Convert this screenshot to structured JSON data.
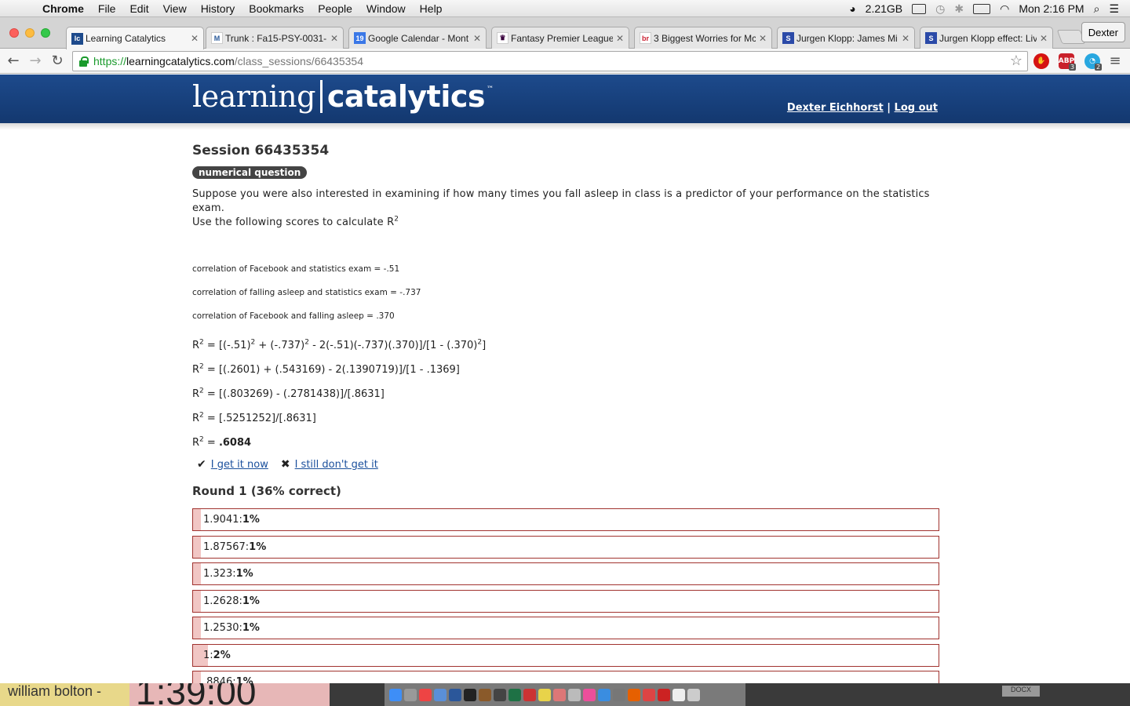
{
  "menubar": {
    "app_name": "Chrome",
    "menus": [
      "File",
      "Edit",
      "View",
      "History",
      "Bookmarks",
      "People",
      "Window",
      "Help"
    ],
    "memory": "2.21GB",
    "clock": "Mon 2:16 PM"
  },
  "tabs": [
    {
      "title": "Learning Catalytics",
      "favicon": "lc",
      "active": true
    },
    {
      "title": "Trunk : Fa15-PSY-0031-",
      "favicon": "trunk"
    },
    {
      "title": "Google Calendar - Mont",
      "favicon": "19"
    },
    {
      "title": "Fantasy Premier League",
      "favicon": "fpl"
    },
    {
      "title": "3 Biggest Worries for Mc",
      "favicon": "br"
    },
    {
      "title": "Jurgen Klopp: James Mi",
      "favicon": "S"
    },
    {
      "title": "Jurgen Klopp effect: Live",
      "favicon": "S"
    }
  ],
  "profile_name": "Dexter",
  "address": {
    "scheme": "https://",
    "host": "learningcatalytics.com",
    "path": "/class_sessions/66435354"
  },
  "extensions": {
    "abp_count": "3",
    "ghostery_count": "2",
    "abp_label": "ABP"
  },
  "site": {
    "logo_left": "learning",
    "logo_right": "catalytics",
    "logo_tm": "™",
    "user_name": "Dexter Eichhorst",
    "separator": "|",
    "logout": "Log out"
  },
  "session": {
    "title": "Session 66435354",
    "question_type": "numerical question",
    "question_line1": "Suppose you were also interested in examining if how many times you fall asleep in class is a predictor of your performance on the statistics exam.",
    "question_line2": "Use the following scores to calculate R",
    "sup2": "2",
    "correlations": [
      "correlation of Facebook and statistics exam = -.51",
      "correlation of falling asleep and statistics exam = -.737",
      "correlation of Facebook and falling asleep = .370"
    ],
    "equations": {
      "eq1_a": "R",
      "eq1_b": " = [(-.51)",
      "eq1_c": " + (-.737)",
      "eq1_d": " - 2(-.51)(-.737)(.370)]/[1 - (.370)",
      "eq1_e": "]",
      "eq2": " = [(.2601) + (.543169) - 2(.1390719)]/[1 - .1369]",
      "eq3": " = [(.803269) - (.2781438)]/[.8631]",
      "eq4": " = [.5251252]/[.8631]",
      "eq5_prefix": " = ",
      "eq5_value": ".6084"
    },
    "feedback_yes": "I get it now",
    "feedback_no": "I still don't get it",
    "round_title": "Round 1 (36% correct)",
    "answers": [
      {
        "value": "1.9041",
        "pct": "1%",
        "fraction": 0.01
      },
      {
        "value": "1.87567",
        "pct": "1%",
        "fraction": 0.01
      },
      {
        "value": "1.323",
        "pct": "1%",
        "fraction": 0.01
      },
      {
        "value": "1.2628",
        "pct": "1%",
        "fraction": 0.01
      },
      {
        "value": "1.2530",
        "pct": "1%",
        "fraction": 0.01
      },
      {
        "value": "1",
        "pct": "2%",
        "fraction": 0.02
      },
      {
        "value": ".8846",
        "pct": "1%",
        "fraction": 0.01
      }
    ]
  },
  "desktop": {
    "left_text": "william bolton -",
    "middle_text": "1:39:00",
    "docx_label": "DOCX"
  }
}
